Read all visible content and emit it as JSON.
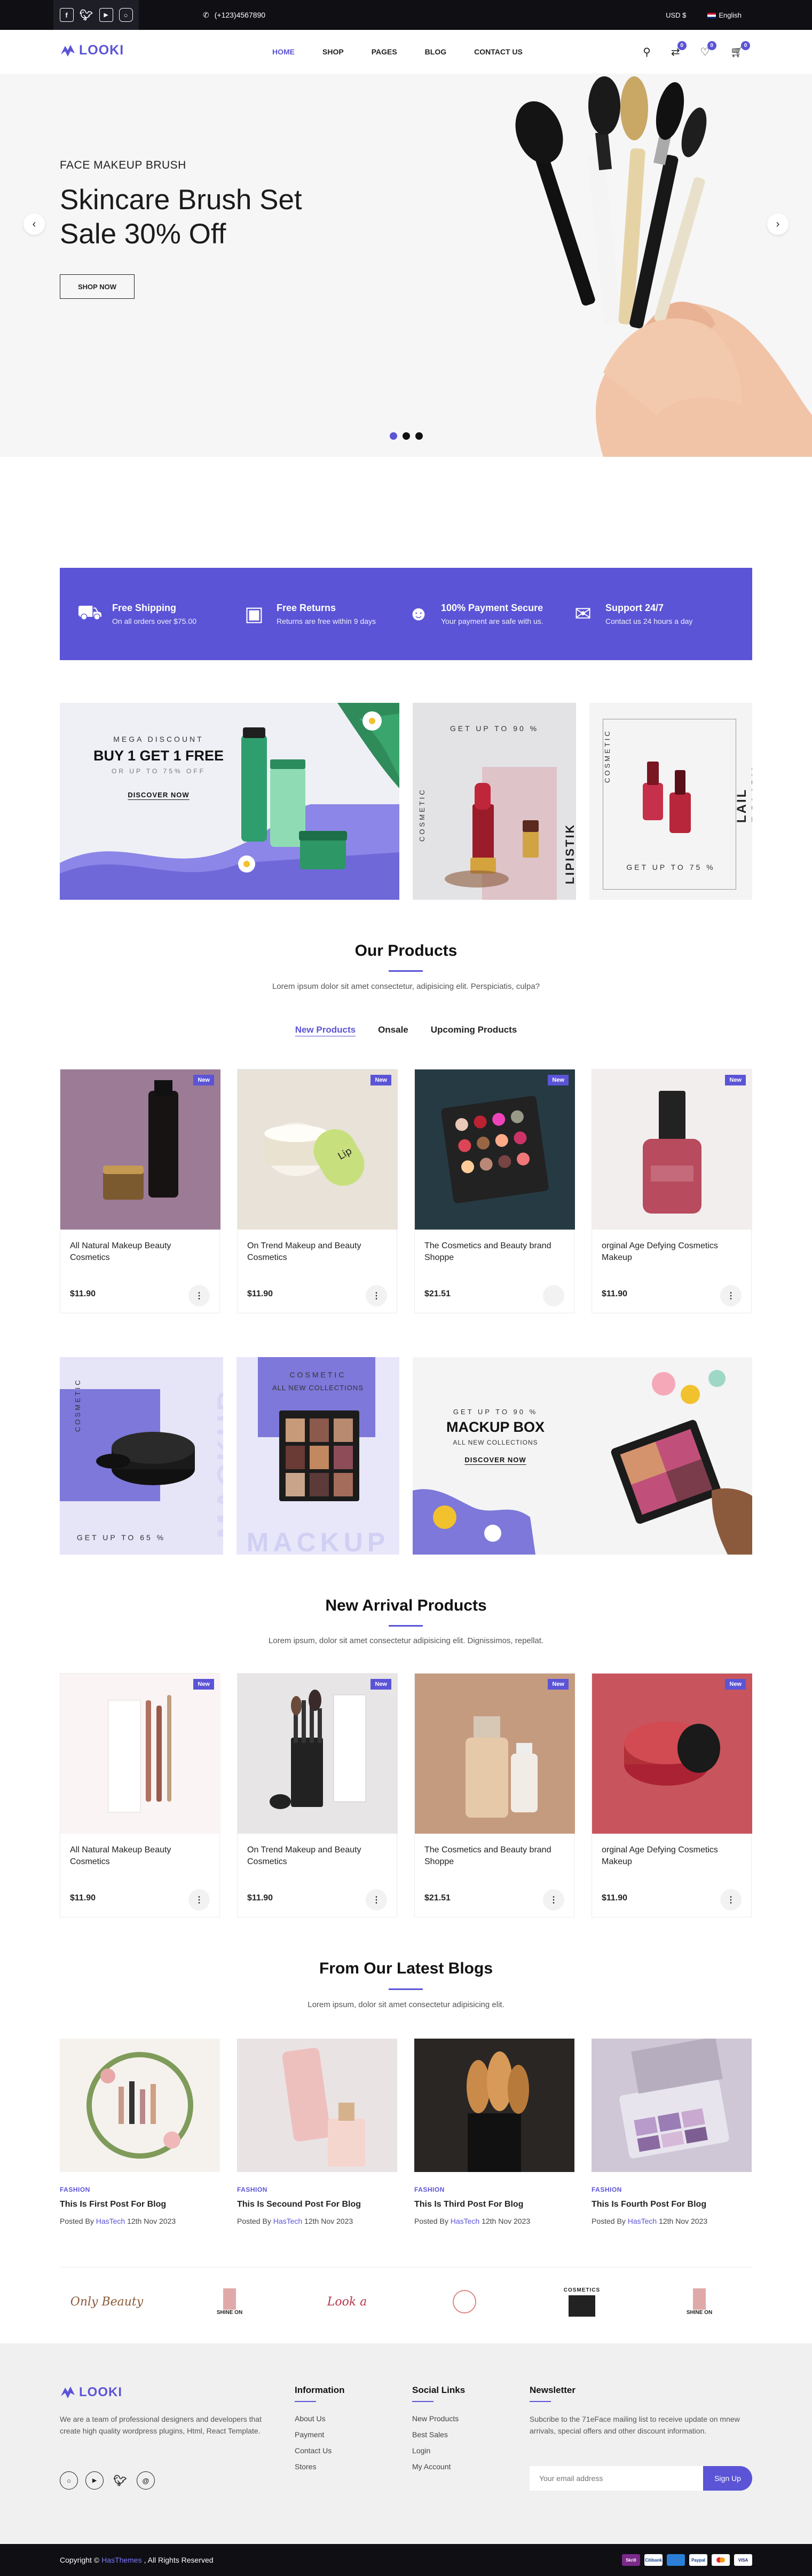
{
  "topbar": {
    "phone": "(+123)4567890",
    "currency": "USD $",
    "language": "English"
  },
  "nav": {
    "logo": "LOOKI",
    "menu": [
      "HOME",
      "SHOP",
      "PAGES",
      "BLOG",
      "CONTACT US"
    ],
    "wishlist_count": "0",
    "compare_count": "0",
    "cart_count": "0"
  },
  "hero": {
    "subtitle": "FACE MAKEUP BRUSH",
    "title_line1": "Skincare Brush Set",
    "title_line2": "Sale 30% Off",
    "button": "SHOP NOW"
  },
  "features": [
    {
      "title": "Free Shipping",
      "desc": "On all orders over $75.00",
      "icon": "truck-icon"
    },
    {
      "title": "Free Returns",
      "desc": "Returns are free within 9 days",
      "icon": "box-icon"
    },
    {
      "title": "100% Payment Secure",
      "desc": "Your payment are safe with us.",
      "icon": "user-shield-icon"
    },
    {
      "title": "Support 24/7",
      "desc": "Contact us 24 hours a day",
      "icon": "support-icon"
    }
  ],
  "banners1": {
    "mega": {
      "top": "MEGA DISCOUNT",
      "title": "BUY 1 GET 1 FREE",
      "sub": "OR UP TO 75% OFF",
      "link": "DISCOVER NOW"
    },
    "lipstick": {
      "top": "GET UP TO 90 %",
      "side": "COSMETIC",
      "label": "LIPISTIK"
    },
    "polish": {
      "side": "COSMETIC",
      "label": "LAIL POLISH",
      "bottom": "GET UP TO 75 %"
    }
  },
  "products_section": {
    "title": "Our Products",
    "subtitle": "Lorem ipsum dolor sit amet consectetur, adipisicing elit. Perspiciatis, culpa?",
    "tabs": [
      "New Products",
      "Onsale",
      "Upcoming Products"
    ]
  },
  "products": [
    {
      "name": "All Natural Makeup Beauty Cosmetics",
      "price": "$11.90",
      "badge": "New"
    },
    {
      "name": "On Trend Makeup and Beauty Cosmetics",
      "price": "$11.90",
      "badge": "New"
    },
    {
      "name": "The Cosmetics and Beauty brand Shoppe",
      "price": "$21.51",
      "badge": "New"
    },
    {
      "name": "orginal Age Defying Cosmetics Makeup",
      "price": "$11.90",
      "badge": "New"
    }
  ],
  "banners2": {
    "eye": {
      "side": "COSMETIC",
      "bottom": "GET UP TO 65 %",
      "watermark": "MACKUP"
    },
    "palette": {
      "top": "COSMETIC",
      "sub": "ALL NEW COLLECTIONS",
      "watermark": "MACKUP"
    },
    "box": {
      "top": "GET UP TO 90 %",
      "title": "MACKUP BOX",
      "sub": "ALL NEW COLLECTIONS",
      "link": "DISCOVER NOW"
    }
  },
  "arrivals_section": {
    "title": "New Arrival Products",
    "subtitle": "Lorem ipsum, dolor sit amet consectetur adipisicing elit. Dignissimos, repellat."
  },
  "arrivals": [
    {
      "name": "All Natural Makeup Beauty Cosmetics",
      "price": "$11.90",
      "badge": "New"
    },
    {
      "name": "On Trend Makeup and Beauty Cosmetics",
      "price": "$11.90",
      "badge": "New"
    },
    {
      "name": "The Cosmetics and Beauty brand Shoppe",
      "price": "$21.51",
      "badge": "New"
    },
    {
      "name": "orginal Age Defying Cosmetics Makeup",
      "price": "$11.90",
      "badge": "New"
    }
  ],
  "blogs_section": {
    "title": "From Our Latest Blogs",
    "subtitle": "Lorem ipsum, dolor sit amet consectetur adipisicing elit."
  },
  "blogs": [
    {
      "category": "FASHION",
      "title": "This Is First Post For Blog",
      "posted": "Posted By",
      "author": "HasTech",
      "date": "12th Nov 2023"
    },
    {
      "category": "FASHION",
      "title": "This Is Secound Post For Blog",
      "posted": "Posted By",
      "author": "HasTech",
      "date": "12th Nov 2023"
    },
    {
      "category": "FASHION",
      "title": "This Is Third Post For Blog",
      "posted": "Posted By",
      "author": "HasTech",
      "date": "12th Nov 2023"
    },
    {
      "category": "FASHION",
      "title": "This Is Fourth Post For Blog",
      "posted": "Posted By",
      "author": "HasTech",
      "date": "12th Nov 2023"
    }
  ],
  "brands": [
    "Only Beauty",
    "SHINE ON",
    "Look a",
    "",
    "COSMETICS",
    "SHINE ON"
  ],
  "footer": {
    "logo": "LOOKI",
    "about": "We are a team of professional designers and developers that create high quality wordpress plugins, Html, React Template.",
    "info_title": "Information",
    "info_links": [
      "About Us",
      "Payment",
      "Contact Us",
      "Stores"
    ],
    "social_title": "Social Links",
    "social_links": [
      "New Products",
      "Best Sales",
      "Login",
      "My Account"
    ],
    "news_title": "Newsletter",
    "news_text": "Subcribe to the 71eFace mailing list to receive update on mnew arrivals, special offers and other discount information.",
    "email_placeholder": "Your email address",
    "signup": "Sign Up",
    "copyright_pre": "Copyright ©",
    "copyright_brand": "HasThemes",
    "copyright_post": ", All Rights Reserved",
    "payments": [
      "Skrill",
      "Citibank",
      "",
      "Paypal",
      "",
      "VISA"
    ]
  },
  "colors": {
    "accent": "#5b54d6",
    "dark": "#0f0f14"
  }
}
